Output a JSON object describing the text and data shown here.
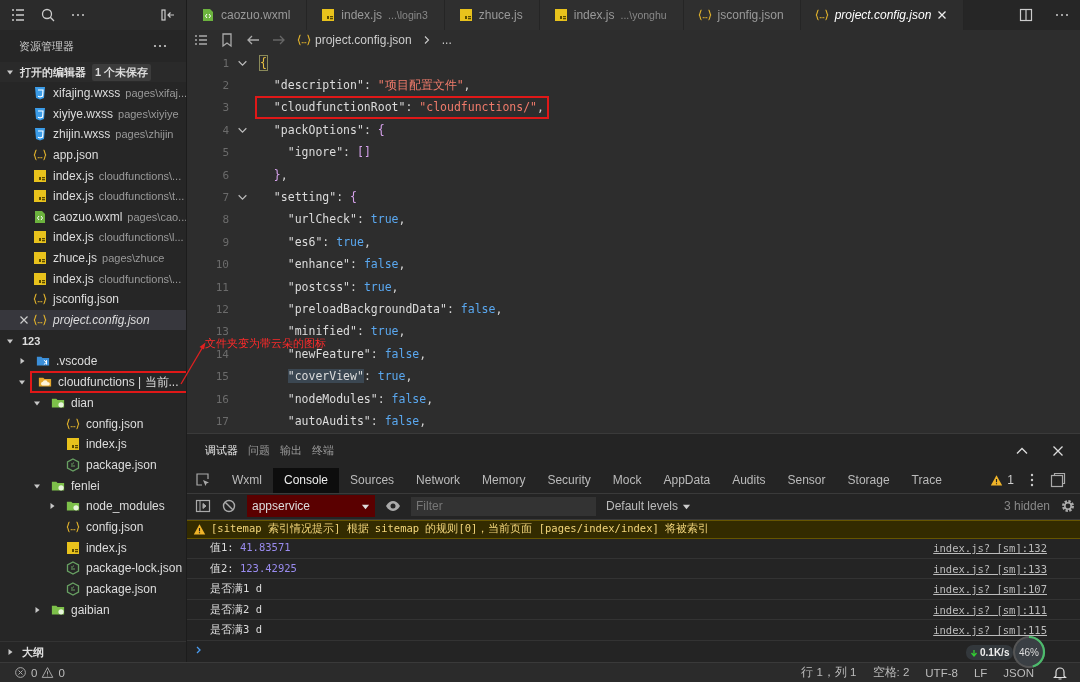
{
  "sidebar": {
    "title": "资源管理器",
    "open_editors": {
      "title": "打开的编辑器",
      "expanded": true,
      "badge": "1 个未保存",
      "items": [
        {
          "name": "xifajing.wxss",
          "path": "pages\\xifaj...",
          "kind": "wxss",
          "selected": false
        },
        {
          "name": "xiyiye.wxss",
          "path": "pages\\xiyiye",
          "kind": "wxss",
          "selected": false
        },
        {
          "name": "zhijin.wxss",
          "path": "pages\\zhijin",
          "kind": "wxss",
          "selected": false
        },
        {
          "name": "app.json",
          "kind": "json",
          "selected": false
        },
        {
          "name": "index.js",
          "path": "cloudfunctions\\...",
          "kind": "js",
          "selected": false
        },
        {
          "name": "index.js",
          "path": "cloudfunctions\\t...",
          "kind": "js",
          "selected": false
        },
        {
          "name": "caozuo.wxml",
          "path": "pages\\cao...",
          "kind": "wxml",
          "selected": false
        },
        {
          "name": "index.js",
          "path": "cloudfunctions\\l...",
          "kind": "js",
          "selected": false
        },
        {
          "name": "zhuce.js",
          "path": "pages\\zhuce",
          "kind": "js",
          "selected": false
        },
        {
          "name": "index.js",
          "path": "cloudfunctions\\...",
          "kind": "js",
          "selected": false
        },
        {
          "name": "jsconfig.json",
          "kind": "json",
          "selected": false
        },
        {
          "name": "project.config.json",
          "kind": "json",
          "selected": true
        }
      ]
    },
    "project": {
      "title": "123",
      "expanded": true,
      "items": [
        {
          "name": ".vscode",
          "kind": "vscode-folder",
          "expanded": false,
          "outlined": false
        },
        {
          "name": "cloudfunctions | 当前...",
          "kind": "cloud-folder",
          "expanded": true,
          "outlined": true,
          "children": [
            {
              "name": "dian",
              "kind": "folder",
              "expanded": true,
              "outlined": false,
              "children": [
                {
                  "name": "config.json",
                  "kind": "json",
                  "outlined": false
                },
                {
                  "name": "index.js",
                  "kind": "js",
                  "outlined": false
                },
                {
                  "name": "package.json",
                  "kind": "node",
                  "outlined": false
                }
              ]
            },
            {
              "name": "fenlei",
              "kind": "folder",
              "expanded": true,
              "outlined": false,
              "children": [
                {
                  "name": "node_modules",
                  "kind": "folder",
                  "expanded": false,
                  "outlined": false
                },
                {
                  "name": "config.json",
                  "kind": "json",
                  "outlined": false
                },
                {
                  "name": "index.js",
                  "kind": "js",
                  "outlined": false
                },
                {
                  "name": "package-lock.json",
                  "kind": "node",
                  "outlined": false
                },
                {
                  "name": "package.json",
                  "kind": "node",
                  "outlined": false
                }
              ]
            },
            {
              "name": "gaibian",
              "kind": "folder",
              "expanded": false,
              "outlined": false
            }
          ]
        }
      ]
    },
    "outline": {
      "title": "大纲",
      "expanded": false
    }
  },
  "editor": {
    "tabs": [
      {
        "name": "caozuo.wxml",
        "kind": "wxml",
        "selected": false
      },
      {
        "name": "index.js",
        "hint": "...\\login3",
        "kind": "js",
        "selected": false
      },
      {
        "name": "zhuce.js",
        "kind": "js",
        "selected": false
      },
      {
        "name": "index.js",
        "hint": "...\\yonghu",
        "kind": "js",
        "selected": false
      },
      {
        "name": "jsconfig.json",
        "kind": "json",
        "selected": false
      },
      {
        "name": "project.config.json",
        "kind": "json",
        "selected": true
      }
    ],
    "breadcrumb": {
      "file": "project.config.json",
      "more": "..."
    },
    "lines": [
      {
        "number": "1",
        "text": "{",
        "foldable": true,
        "outlined": false,
        "highlighted": true
      },
      {
        "number": "2",
        "text": "  \"description\": \"项目配置文件\",",
        "foldable": false,
        "outlined": false,
        "highlighted": false
      },
      {
        "number": "3",
        "text": "  \"cloudfunctionRoot\": \"cloudfunctions/\",",
        "foldable": false,
        "outlined": true,
        "highlighted": false
      },
      {
        "number": "4",
        "text": "  \"packOptions\": {",
        "foldable": true,
        "outlined": false,
        "highlighted": false
      },
      {
        "number": "5",
        "text": "    \"ignore\": []",
        "foldable": false,
        "outlined": false,
        "highlighted": false
      },
      {
        "number": "6",
        "text": "  },",
        "foldable": false,
        "outlined": false,
        "highlighted": false
      },
      {
        "number": "7",
        "text": "  \"setting\": {",
        "foldable": true,
        "outlined": false,
        "highlighted": false
      },
      {
        "number": "8",
        "text": "    \"urlCheck\": true,",
        "foldable": false,
        "outlined": false,
        "highlighted": false
      },
      {
        "number": "9",
        "text": "    \"es6\": true,",
        "foldable": false,
        "outlined": false,
        "highlighted": false
      },
      {
        "number": "10",
        "text": "    \"enhance\": false,",
        "foldable": false,
        "outlined": false,
        "highlighted": false
      },
      {
        "number": "11",
        "text": "    \"postcss\": true,",
        "foldable": false,
        "outlined": false,
        "highlighted": false
      },
      {
        "number": "12",
        "text": "    \"preloadBackgroundData\": false,",
        "foldable": false,
        "outlined": false,
        "highlighted": false
      },
      {
        "number": "13",
        "text": "    \"minified\": true,",
        "foldable": false,
        "outlined": false,
        "highlighted": false
      },
      {
        "number": "14",
        "text": "    \"newFeature\": false,",
        "foldable": false,
        "outlined": false,
        "highlighted": false
      },
      {
        "number": "15",
        "text": "    \"coverView\": true,",
        "foldable": false,
        "outlined": false,
        "highlighted": true
      },
      {
        "number": "16",
        "text": "    \"nodeModules\": false,",
        "foldable": false,
        "outlined": false,
        "highlighted": false
      },
      {
        "number": "17",
        "text": "    \"autoAudits\": false,",
        "foldable": false,
        "outlined": false,
        "highlighted": false
      }
    ]
  },
  "annotation": {
    "text": "文件夹变为带云朵的图标"
  },
  "panel": {
    "tabs": [
      {
        "label": "调试器",
        "selected": true
      },
      {
        "label": "问题",
        "selected": false
      },
      {
        "label": "输出",
        "selected": false
      },
      {
        "label": "终端",
        "selected": false
      }
    ],
    "devtools_tabs": [
      {
        "label": "Wxml",
        "selected": false
      },
      {
        "label": "Console",
        "selected": true
      },
      {
        "label": "Sources",
        "selected": false
      },
      {
        "label": "Network",
        "selected": false
      },
      {
        "label": "Memory",
        "selected": false
      },
      {
        "label": "Security",
        "selected": false
      },
      {
        "label": "Mock",
        "selected": false
      },
      {
        "label": "AppData",
        "selected": false
      },
      {
        "label": "Audits",
        "selected": false
      },
      {
        "label": "Sensor",
        "selected": false
      },
      {
        "label": "Storage",
        "selected": false
      },
      {
        "label": "Trace",
        "selected": false
      }
    ],
    "warning_count": "1",
    "context": "appservice",
    "filter_placeholder": "Filter",
    "levels": "Default levels",
    "hidden": "3 hidden",
    "rows": [
      {
        "kind": "warning",
        "text": "[sitemap 索引情况提示] 根据 sitemap 的规则[0]，当前页面 [pages/index/index] 将被索引"
      },
      {
        "kind": "log",
        "text": "值1: ",
        "number": "41.83571",
        "source": "index.js? [sm]:132"
      },
      {
        "kind": "log",
        "text": "值2: ",
        "number": "123.42925",
        "source": "index.js? [sm]:133"
      },
      {
        "kind": "log",
        "text": "是否满1 d",
        "source": "index.js? [sm]:107"
      },
      {
        "kind": "log",
        "text": "是否满2 d",
        "source": "index.js? [sm]:111"
      },
      {
        "kind": "log",
        "text": "是否满3 d",
        "source": "index.js? [sm]:115"
      }
    ]
  },
  "speed_widget": {
    "speed": "0.1K/s",
    "percent": "46%",
    "level": 0.46
  },
  "status_bar": {
    "errors": "0",
    "warnings": "0",
    "position": "行 1，列 1",
    "indent": "空格: 2",
    "encoding": "UTF-8",
    "eol": "LF",
    "language": "JSON"
  }
}
